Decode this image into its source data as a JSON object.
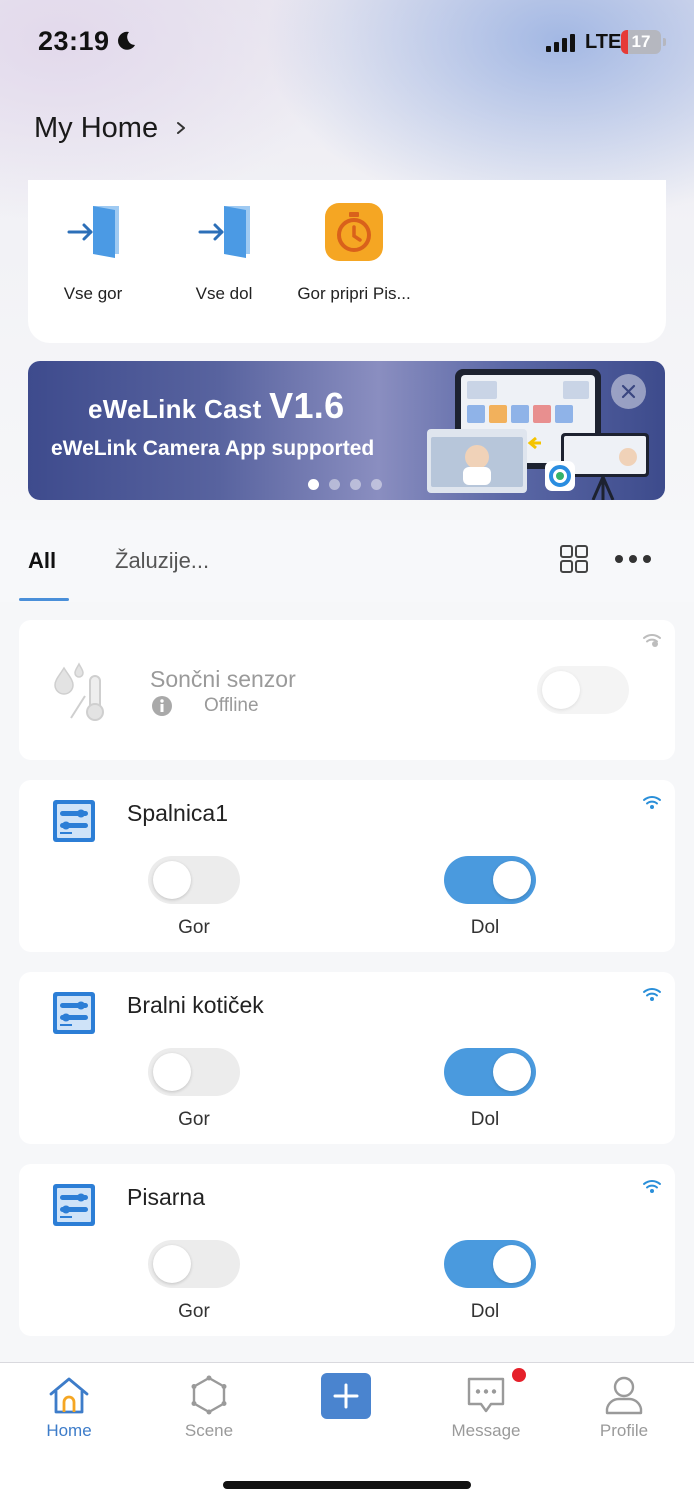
{
  "status_bar": {
    "time": "23:19",
    "network": "LTE",
    "battery_level": "17",
    "battery_percent": 17
  },
  "header": {
    "home_name": "My Home"
  },
  "scenes": [
    {
      "label": "Vse gor",
      "icon": "door-enter-icon"
    },
    {
      "label": "Vse dol",
      "icon": "door-enter-icon"
    },
    {
      "label": "Gor pripri Pis...",
      "icon": "timer-icon"
    }
  ],
  "banner": {
    "title": "eWeLink Cast ",
    "version": "V1.6",
    "subtitle": "eWeLink Camera App supported",
    "page_count": 4,
    "active_page": 1
  },
  "tabs": {
    "all": "All",
    "blinds": "Žaluzije..."
  },
  "devices": {
    "sensor": {
      "name": "Sončni senzor",
      "status": "Offline",
      "online": false
    },
    "spalnica": {
      "name": "Spalnica1",
      "up_label": "Gor",
      "down_label": "Dol",
      "up_on": false,
      "down_on": true
    },
    "bralni": {
      "name": "Bralni kotiček",
      "up_label": "Gor",
      "down_label": "Dol",
      "up_on": false,
      "down_on": true
    },
    "pisarna": {
      "name": "Pisarna",
      "up_label": "Gor",
      "down_label": "Dol",
      "up_on": false,
      "down_on": true
    }
  },
  "bottom_nav": {
    "home": "Home",
    "scene": "Scene",
    "message": "Message",
    "profile": "Profile"
  },
  "colors": {
    "accent": "#4a9ade",
    "nav_active": "#3d7cc9",
    "battery_low": "#e63a36",
    "badge": "#e5202a",
    "scene_timer": "#f5a623"
  }
}
